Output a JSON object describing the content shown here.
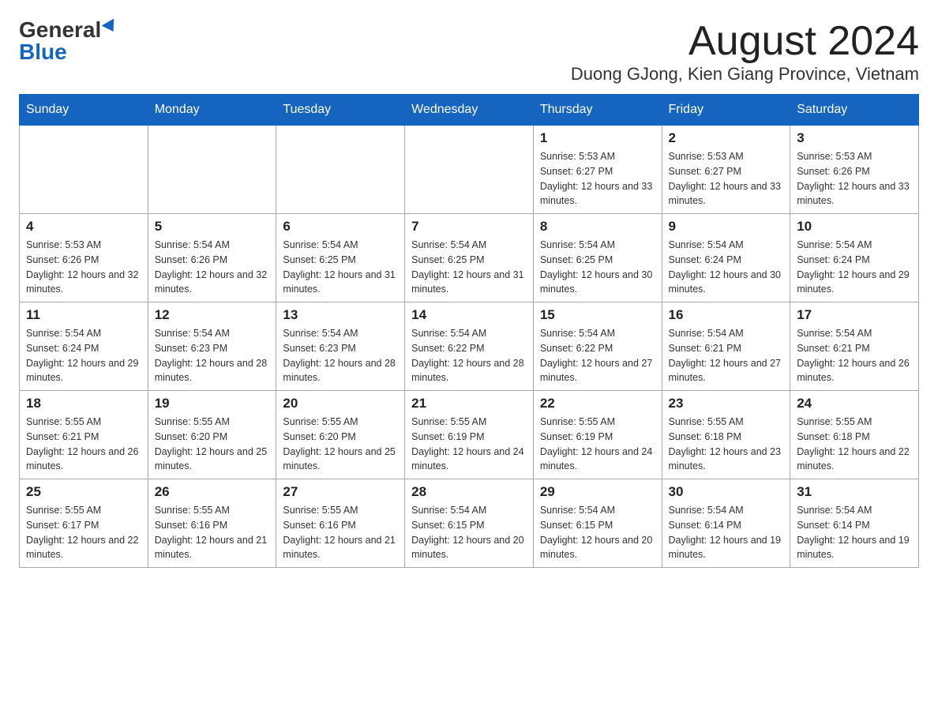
{
  "logo": {
    "general": "General",
    "blue": "Blue"
  },
  "title": "August 2024",
  "location": "Duong GJong, Kien Giang Province, Vietnam",
  "days_of_week": [
    "Sunday",
    "Monday",
    "Tuesday",
    "Wednesday",
    "Thursday",
    "Friday",
    "Saturday"
  ],
  "weeks": [
    [
      {
        "day": "",
        "info": ""
      },
      {
        "day": "",
        "info": ""
      },
      {
        "day": "",
        "info": ""
      },
      {
        "day": "",
        "info": ""
      },
      {
        "day": "1",
        "info": "Sunrise: 5:53 AM\nSunset: 6:27 PM\nDaylight: 12 hours and 33 minutes."
      },
      {
        "day": "2",
        "info": "Sunrise: 5:53 AM\nSunset: 6:27 PM\nDaylight: 12 hours and 33 minutes."
      },
      {
        "day": "3",
        "info": "Sunrise: 5:53 AM\nSunset: 6:26 PM\nDaylight: 12 hours and 33 minutes."
      }
    ],
    [
      {
        "day": "4",
        "info": "Sunrise: 5:53 AM\nSunset: 6:26 PM\nDaylight: 12 hours and 32 minutes."
      },
      {
        "day": "5",
        "info": "Sunrise: 5:54 AM\nSunset: 6:26 PM\nDaylight: 12 hours and 32 minutes."
      },
      {
        "day": "6",
        "info": "Sunrise: 5:54 AM\nSunset: 6:25 PM\nDaylight: 12 hours and 31 minutes."
      },
      {
        "day": "7",
        "info": "Sunrise: 5:54 AM\nSunset: 6:25 PM\nDaylight: 12 hours and 31 minutes."
      },
      {
        "day": "8",
        "info": "Sunrise: 5:54 AM\nSunset: 6:25 PM\nDaylight: 12 hours and 30 minutes."
      },
      {
        "day": "9",
        "info": "Sunrise: 5:54 AM\nSunset: 6:24 PM\nDaylight: 12 hours and 30 minutes."
      },
      {
        "day": "10",
        "info": "Sunrise: 5:54 AM\nSunset: 6:24 PM\nDaylight: 12 hours and 29 minutes."
      }
    ],
    [
      {
        "day": "11",
        "info": "Sunrise: 5:54 AM\nSunset: 6:24 PM\nDaylight: 12 hours and 29 minutes."
      },
      {
        "day": "12",
        "info": "Sunrise: 5:54 AM\nSunset: 6:23 PM\nDaylight: 12 hours and 28 minutes."
      },
      {
        "day": "13",
        "info": "Sunrise: 5:54 AM\nSunset: 6:23 PM\nDaylight: 12 hours and 28 minutes."
      },
      {
        "day": "14",
        "info": "Sunrise: 5:54 AM\nSunset: 6:22 PM\nDaylight: 12 hours and 28 minutes."
      },
      {
        "day": "15",
        "info": "Sunrise: 5:54 AM\nSunset: 6:22 PM\nDaylight: 12 hours and 27 minutes."
      },
      {
        "day": "16",
        "info": "Sunrise: 5:54 AM\nSunset: 6:21 PM\nDaylight: 12 hours and 27 minutes."
      },
      {
        "day": "17",
        "info": "Sunrise: 5:54 AM\nSunset: 6:21 PM\nDaylight: 12 hours and 26 minutes."
      }
    ],
    [
      {
        "day": "18",
        "info": "Sunrise: 5:55 AM\nSunset: 6:21 PM\nDaylight: 12 hours and 26 minutes."
      },
      {
        "day": "19",
        "info": "Sunrise: 5:55 AM\nSunset: 6:20 PM\nDaylight: 12 hours and 25 minutes."
      },
      {
        "day": "20",
        "info": "Sunrise: 5:55 AM\nSunset: 6:20 PM\nDaylight: 12 hours and 25 minutes."
      },
      {
        "day": "21",
        "info": "Sunrise: 5:55 AM\nSunset: 6:19 PM\nDaylight: 12 hours and 24 minutes."
      },
      {
        "day": "22",
        "info": "Sunrise: 5:55 AM\nSunset: 6:19 PM\nDaylight: 12 hours and 24 minutes."
      },
      {
        "day": "23",
        "info": "Sunrise: 5:55 AM\nSunset: 6:18 PM\nDaylight: 12 hours and 23 minutes."
      },
      {
        "day": "24",
        "info": "Sunrise: 5:55 AM\nSunset: 6:18 PM\nDaylight: 12 hours and 22 minutes."
      }
    ],
    [
      {
        "day": "25",
        "info": "Sunrise: 5:55 AM\nSunset: 6:17 PM\nDaylight: 12 hours and 22 minutes."
      },
      {
        "day": "26",
        "info": "Sunrise: 5:55 AM\nSunset: 6:16 PM\nDaylight: 12 hours and 21 minutes."
      },
      {
        "day": "27",
        "info": "Sunrise: 5:55 AM\nSunset: 6:16 PM\nDaylight: 12 hours and 21 minutes."
      },
      {
        "day": "28",
        "info": "Sunrise: 5:54 AM\nSunset: 6:15 PM\nDaylight: 12 hours and 20 minutes."
      },
      {
        "day": "29",
        "info": "Sunrise: 5:54 AM\nSunset: 6:15 PM\nDaylight: 12 hours and 20 minutes."
      },
      {
        "day": "30",
        "info": "Sunrise: 5:54 AM\nSunset: 6:14 PM\nDaylight: 12 hours and 19 minutes."
      },
      {
        "day": "31",
        "info": "Sunrise: 5:54 AM\nSunset: 6:14 PM\nDaylight: 12 hours and 19 minutes."
      }
    ]
  ]
}
